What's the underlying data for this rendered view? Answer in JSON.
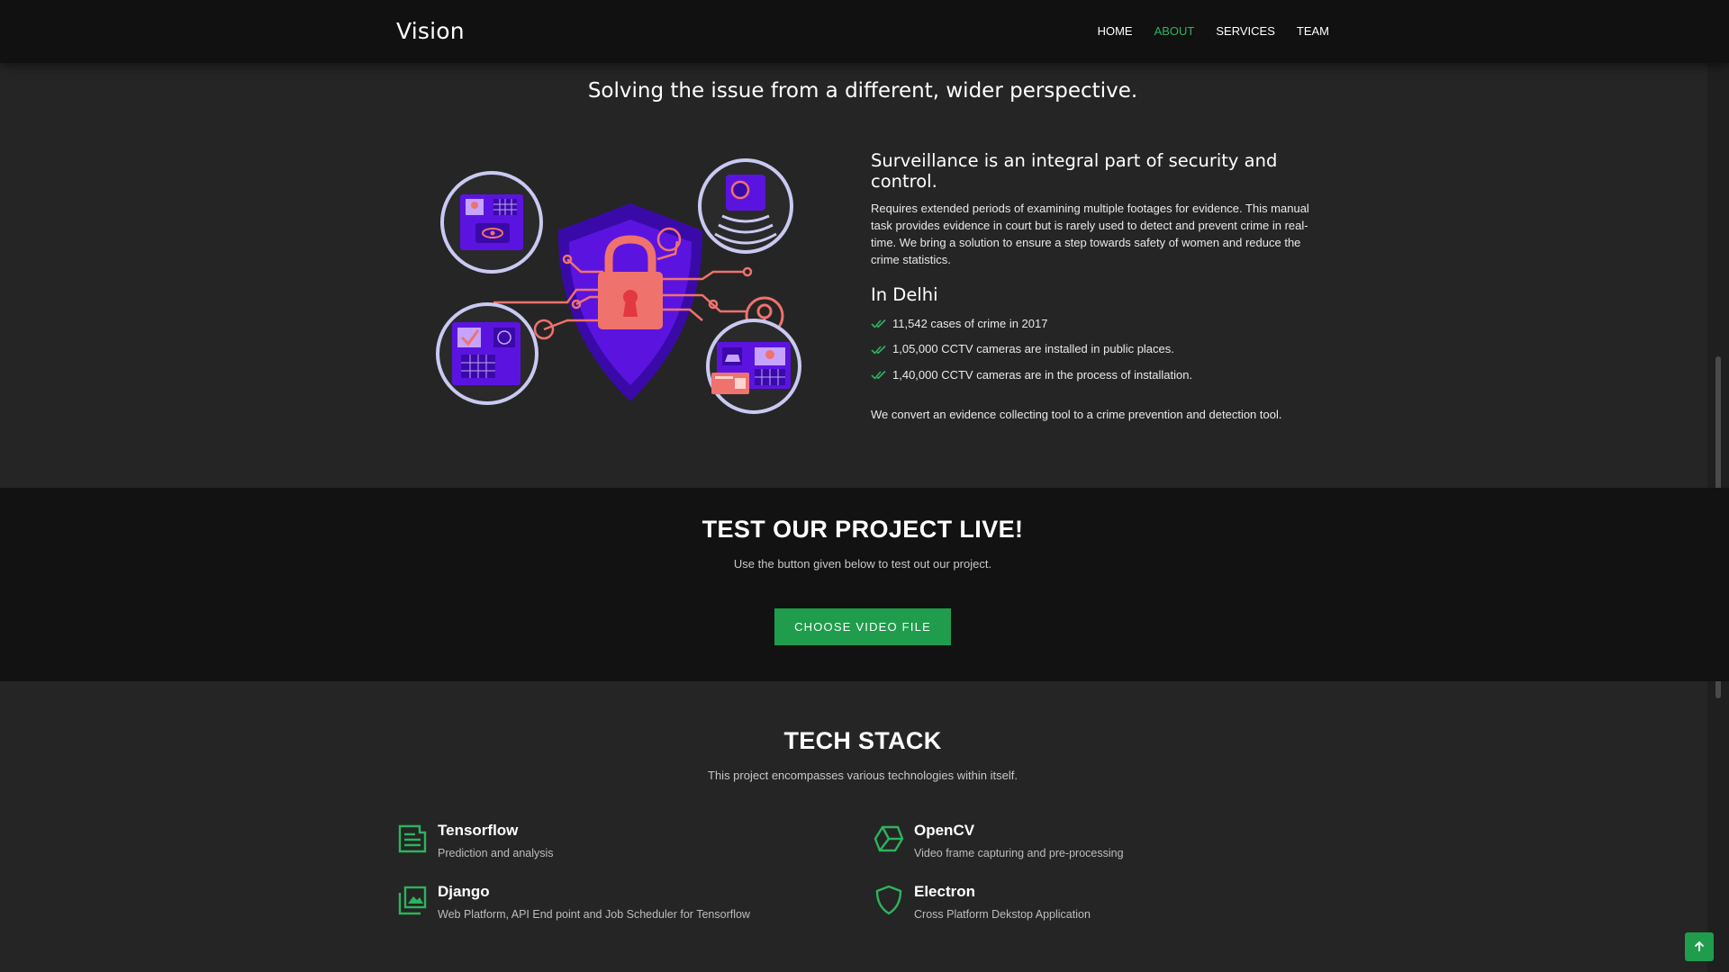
{
  "header": {
    "brand": "Vision",
    "nav": [
      "HOME",
      "ABOUT",
      "SERVICES",
      "TEAM"
    ],
    "active_nav": "ABOUT"
  },
  "about": {
    "tagline": "Solving the issue from a different, wider perspective.",
    "heading": "Surveillance is an integral part of security and control.",
    "body": "Requires extended periods of examining multiple footages for evidence. This manual task provides evidence in court but is rarely used to detect and prevent crime in real-time. We bring a solution to ensure a step towards safety of women and reduce the crime statistics.",
    "delhi_title": "In Delhi",
    "facts": [
      "11,542 cases of crime in 2017",
      "1,05,000 CCTV cameras are installed in public places.",
      "1,40,000 CCTV cameras are in the process of installation."
    ],
    "conclusion": "We convert an evidence collecting tool to a crime prevention and detection tool."
  },
  "cta": {
    "title": "TEST OUR PROJECT LIVE!",
    "subtitle": "Use the button given below to test out our project.",
    "button_label": "CHOOSE VIDEO FILE"
  },
  "tech": {
    "title": "TECH STACK",
    "subtitle": "This project encompasses various technologies within itself.",
    "items": [
      {
        "name": "Tensorflow",
        "desc": "Prediction and analysis",
        "icon": "document-icon"
      },
      {
        "name": "OpenCV",
        "desc": "Video frame capturing and pre-processing",
        "icon": "cube-icon"
      },
      {
        "name": "Django",
        "desc": "Web Platform, API End point and Job Scheduler for Tensorflow",
        "icon": "images-icon"
      },
      {
        "name": "Electron",
        "desc": "Cross Platform Dekstop Application",
        "icon": "shield-icon"
      }
    ]
  },
  "colors": {
    "accent": "#2db35d",
    "button": "#1f9d4c",
    "background": "#252525",
    "header": "#111111",
    "cta_band": "#121212"
  },
  "icons": {
    "check": "double-check-icon",
    "back_to_top": "arrow-up-icon"
  }
}
